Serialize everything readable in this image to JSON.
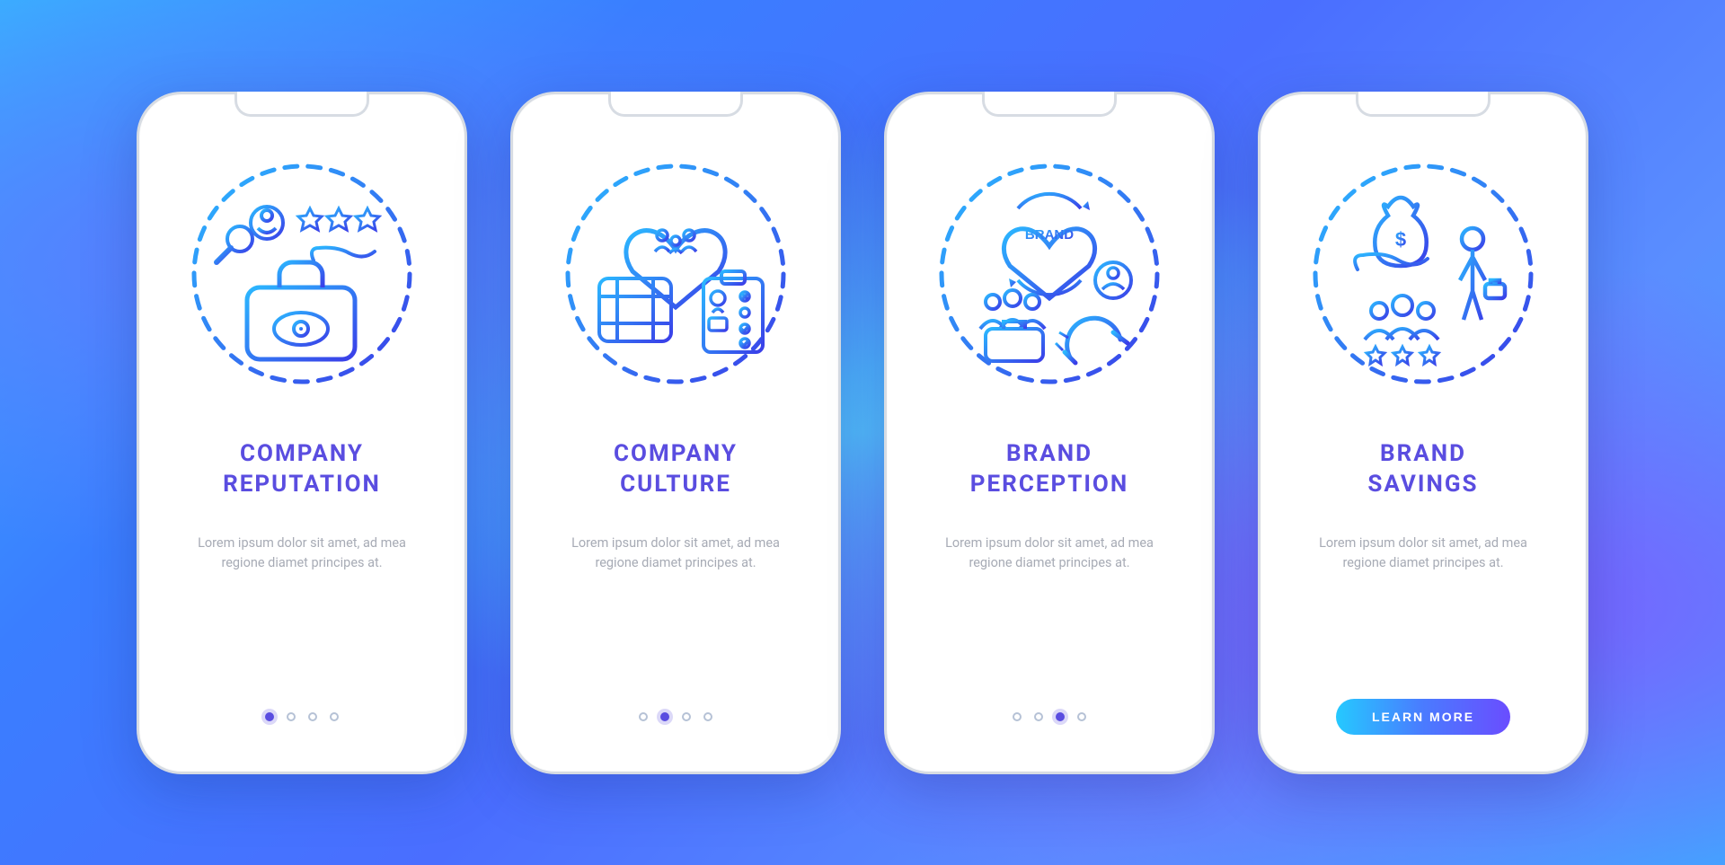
{
  "colors": {
    "title": "#5a4de0",
    "desc": "#a7abb5",
    "dashed": "#3b52e8"
  },
  "cta_label": "LEARN MORE",
  "total_slides": 4,
  "cards": [
    {
      "icon": "reputation-icon",
      "title": "COMPANY\nREPUTATION",
      "desc": "Lorem ipsum dolor sit amet, ad mea regione diamet principes at.",
      "active_index": 0,
      "show_cta": false
    },
    {
      "icon": "culture-icon",
      "title": "COMPANY\nCULTURE",
      "desc": "Lorem ipsum dolor sit amet, ad mea regione diamet principes at.",
      "active_index": 1,
      "show_cta": false
    },
    {
      "icon": "perception-icon",
      "title": "BRAND\nPERCEPTION",
      "desc": "Lorem ipsum dolor sit amet, ad mea regione diamet principes at.",
      "active_index": 2,
      "show_cta": false
    },
    {
      "icon": "savings-icon",
      "title": "BRAND\nSAVINGS",
      "desc": "Lorem ipsum dolor sit amet, ad mea regione diamet principes at.",
      "active_index": 3,
      "show_cta": true
    }
  ]
}
